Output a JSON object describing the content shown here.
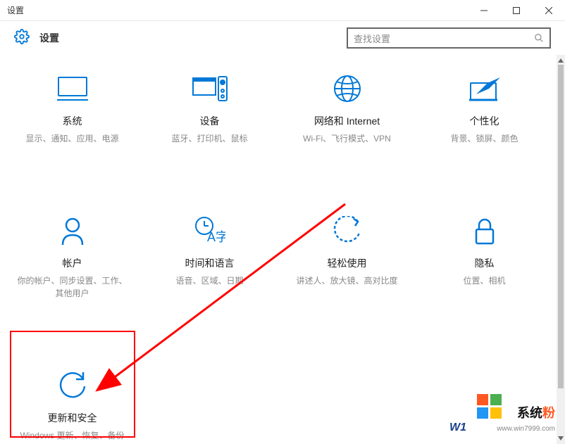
{
  "window_title": "设置",
  "header": {
    "title": "设置",
    "search_placeholder": "查找设置"
  },
  "tiles": [
    {
      "icon": "system",
      "title": "系统",
      "desc": "显示、通知、应用、电源"
    },
    {
      "icon": "devices",
      "title": "设备",
      "desc": "蓝牙、打印机、鼠标"
    },
    {
      "icon": "network",
      "title": "网络和 Internet",
      "desc": "Wi-Fi、飞行模式、VPN"
    },
    {
      "icon": "personal",
      "title": "个性化",
      "desc": "背景、锁屏、颜色"
    },
    {
      "icon": "account",
      "title": "帐户",
      "desc": "你的帐户、同步设置、工作、其他用户"
    },
    {
      "icon": "time",
      "title": "时间和语言",
      "desc": "语音、区域、日期"
    },
    {
      "icon": "ease",
      "title": "轻松使用",
      "desc": "讲述人、放大镜、高对比度"
    },
    {
      "icon": "privacy",
      "title": "隐私",
      "desc": "位置、相机"
    },
    {
      "icon": "update",
      "title": "更新和安全",
      "desc": "Windows 更新、恢复、备份"
    }
  ],
  "watermark": {
    "brand_main": "系统",
    "brand_accent": "粉",
    "url": "www.win7999.com",
    "partial": "W1"
  }
}
